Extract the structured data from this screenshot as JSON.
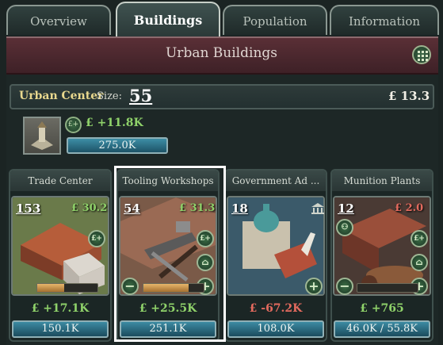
{
  "tabs": [
    {
      "label": "Overview",
      "active": false
    },
    {
      "label": "Buildings",
      "active": true
    },
    {
      "label": "Population",
      "active": false
    },
    {
      "label": "Information",
      "active": false
    }
  ],
  "header": {
    "title": "Urban Buildings"
  },
  "urban_center": {
    "label": "Urban Center",
    "size_label": "Size:",
    "size": "55",
    "money": "£ 13.3",
    "income": "£ +11.8K",
    "bar_value": "275.0K"
  },
  "buildings": [
    {
      "name": "Trade Center",
      "level": "153",
      "profit": "£ 30.2",
      "profit_positive": true,
      "income": "£ +17.1K",
      "income_positive": true,
      "bar": "150.1K",
      "progress": 0.45
    },
    {
      "name": "Tooling Workshops",
      "level": "54",
      "profit": "£ 31.3",
      "profit_positive": true,
      "income": "£ +25.5K",
      "income_positive": true,
      "bar": "251.1K",
      "progress": 0.75
    },
    {
      "name": "Government Ad ...",
      "level": "18",
      "profit": "",
      "profit_positive": true,
      "income": "£ -67.2K",
      "income_positive": false,
      "bar": "108.0K",
      "progress": 0
    },
    {
      "name": "Munition Plants",
      "level": "12",
      "profit": "£ 2.0",
      "profit_positive": false,
      "income": "£ +765",
      "income_positive": true,
      "bar": "46.0K / 55.8K",
      "progress": 0.0
    }
  ],
  "colors": {
    "positive": "#8fd26a",
    "negative": "#e36a5e"
  }
}
